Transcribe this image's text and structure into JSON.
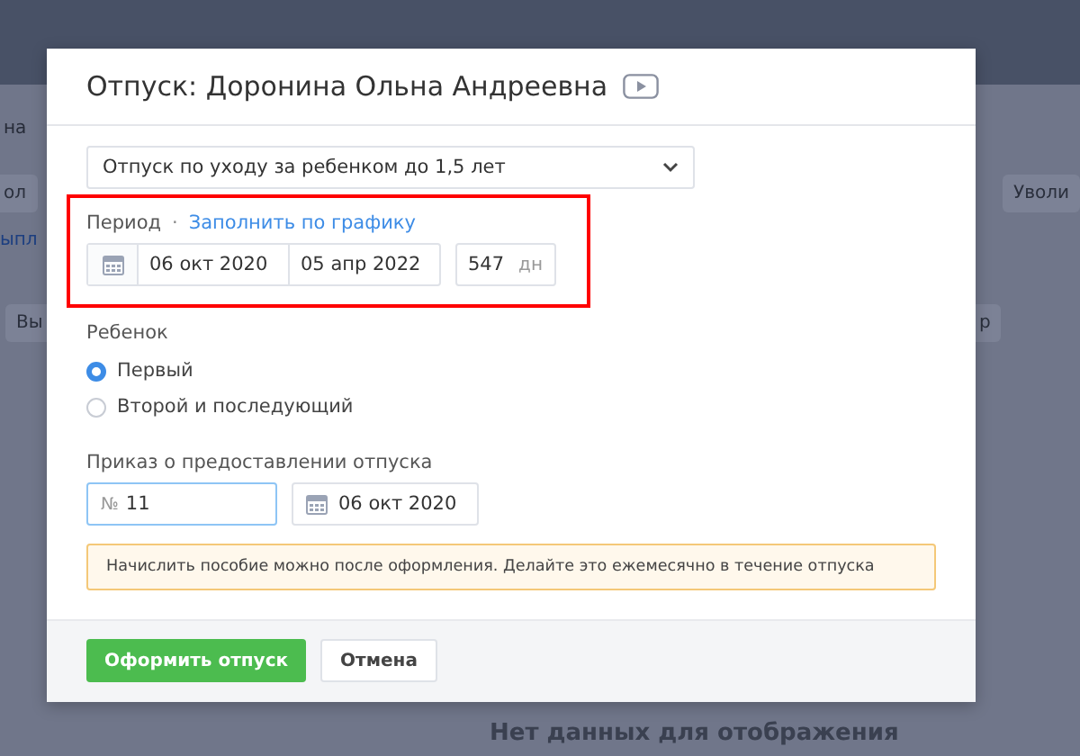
{
  "background_page": {
    "employee_name": "на",
    "left_button": "ол",
    "right_button": "Уволи",
    "tab": "ыпл",
    "action_button": "Вы",
    "filter_button": "р",
    "empty_message": "Нет данных для отображения"
  },
  "dialog": {
    "title": "Отпуск: Доронина Ольна Андреевна",
    "leave_type": {
      "value": "Отпуск по уходу за ребенком до 1,5 лет"
    },
    "period": {
      "label": "Период",
      "separator": "·",
      "link": "Заполнить по графику",
      "highlighted": true,
      "start": "06 окт 2020",
      "end": "05 апр 2022",
      "days": "547",
      "days_unit": "дн"
    },
    "child": {
      "label": "Ребенок",
      "options": [
        {
          "label": "Первый",
          "selected": true
        },
        {
          "label": "Второй и последующий",
          "selected": false
        }
      ]
    },
    "order": {
      "label": "Приказ о предоставлении отпуска",
      "number_prefix": "№",
      "number": "11",
      "number_focused": true,
      "date": "06 окт 2020"
    },
    "notice": "Начислить пособие можно после оформления. Делайте это ежемесячно в течение отпуска",
    "buttons": [
      {
        "label": "Оформить отпуск",
        "kind": "primary"
      },
      {
        "label": "Отмена",
        "kind": "secondary"
      }
    ]
  }
}
